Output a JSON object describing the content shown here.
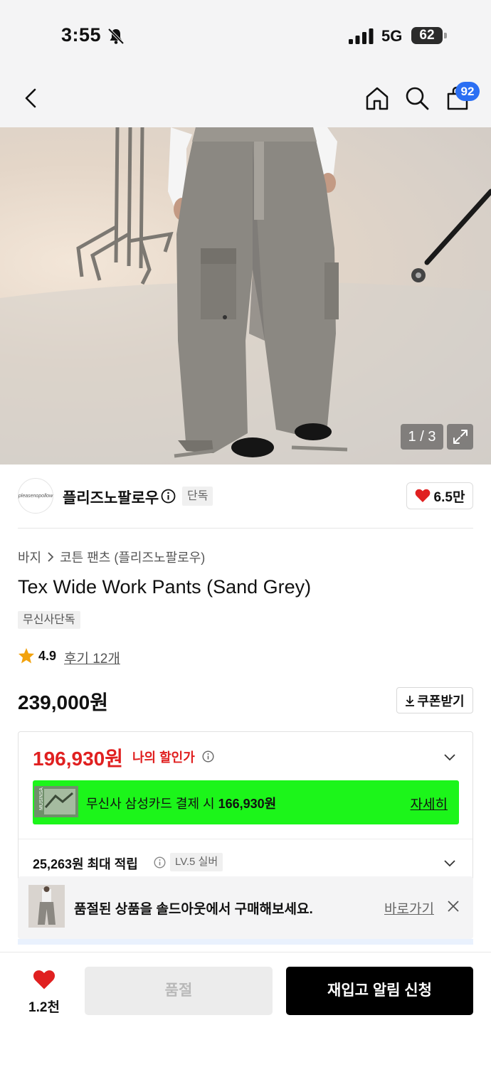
{
  "status_bar": {
    "time": "3:55",
    "network": "5G",
    "battery": "62"
  },
  "header": {
    "cart_count": "92"
  },
  "hero": {
    "counter": "1 / 3"
  },
  "brand": {
    "logo_text": "pleasenopollow",
    "name": "플리즈노팔로우",
    "tag": "단독",
    "likes": "6.5만"
  },
  "product": {
    "breadcrumb": [
      "바지",
      "코튼 팬츠 (플리즈노팔로우)"
    ],
    "title": "Tex Wide Work Pants (Sand Grey)",
    "exclusive_tag": "무신사단독",
    "rating": "4.9",
    "reviews": "후기 12개",
    "price": "239,000원",
    "coupon_label": "쿠폰받기"
  },
  "discount": {
    "sale_price": "196,930원",
    "label": "나의 할인가",
    "card_text": "무신사 삼성카드 결제 시 ",
    "card_price": "166,930원",
    "card_more": "자세히",
    "card_thumb_text": "MUSINSA",
    "points": "25,263원 최대 적립",
    "level": "LV.5 실버"
  },
  "toast": {
    "text": "품절된 상품을 솔드아웃에서 구매해보세요.",
    "link": "바로가기"
  },
  "bottom": {
    "like_count": "1.2천",
    "soldout_label": "품절",
    "restock_label": "재입고 알림 신청"
  },
  "colors": {
    "accent_red": "#e02020",
    "card_green": "#1cf51a",
    "badge_blue": "#2b6ff3"
  }
}
